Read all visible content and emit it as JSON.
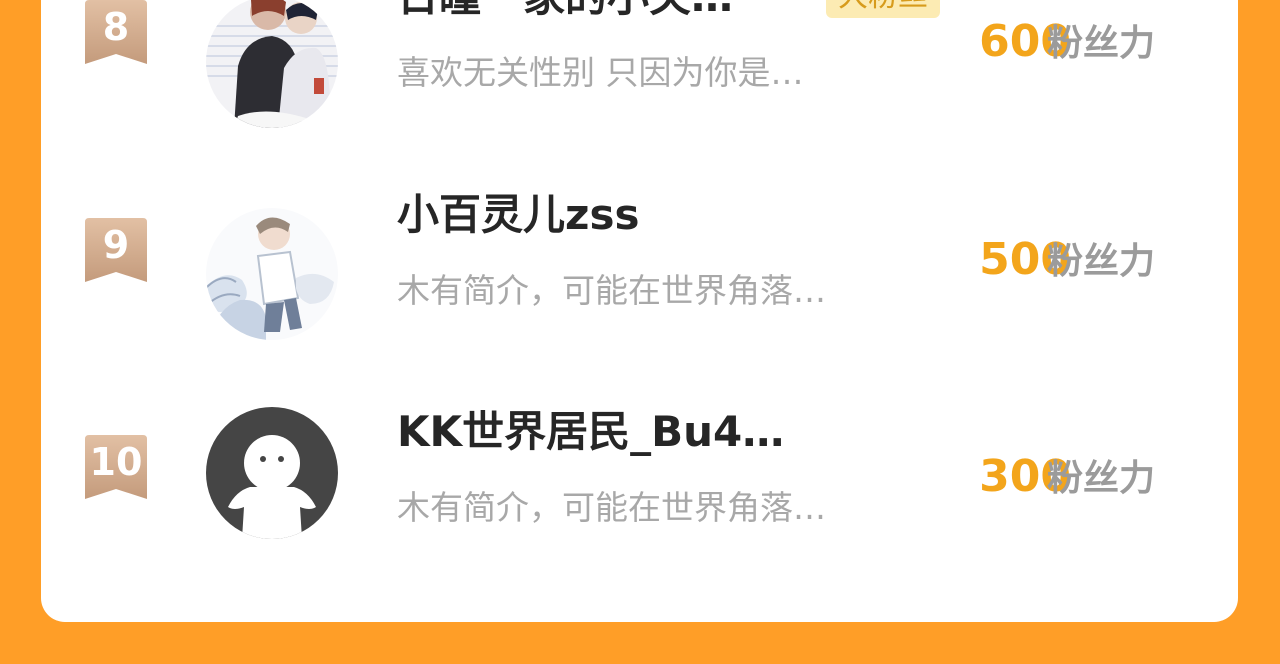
{
  "rows": [
    {
      "rank": "8",
      "name": "日瞳一家的小关…",
      "badge": "大粉丝",
      "bio": "喜欢无关性别 只因为你是…",
      "score": "600",
      "unit": "粉丝力"
    },
    {
      "rank": "9",
      "name": "小百灵儿zss",
      "bio": "木有简介，可能在世界角落…",
      "score": "500",
      "unit": "粉丝力"
    },
    {
      "rank": "10",
      "name": "KK世界居民_Bu4…",
      "bio": "木有简介，可能在世界角落…",
      "score": "300",
      "unit": "粉丝力"
    }
  ],
  "colors": {
    "background": "#ff9e27",
    "score": "#f3a51b",
    "badge_bg": "#fcebb3",
    "badge_text": "#d79b1c",
    "rank_ribbon": "#c9a285"
  },
  "icons": [
    "rank-ribbon-icon",
    "default-avatar-icon"
  ]
}
